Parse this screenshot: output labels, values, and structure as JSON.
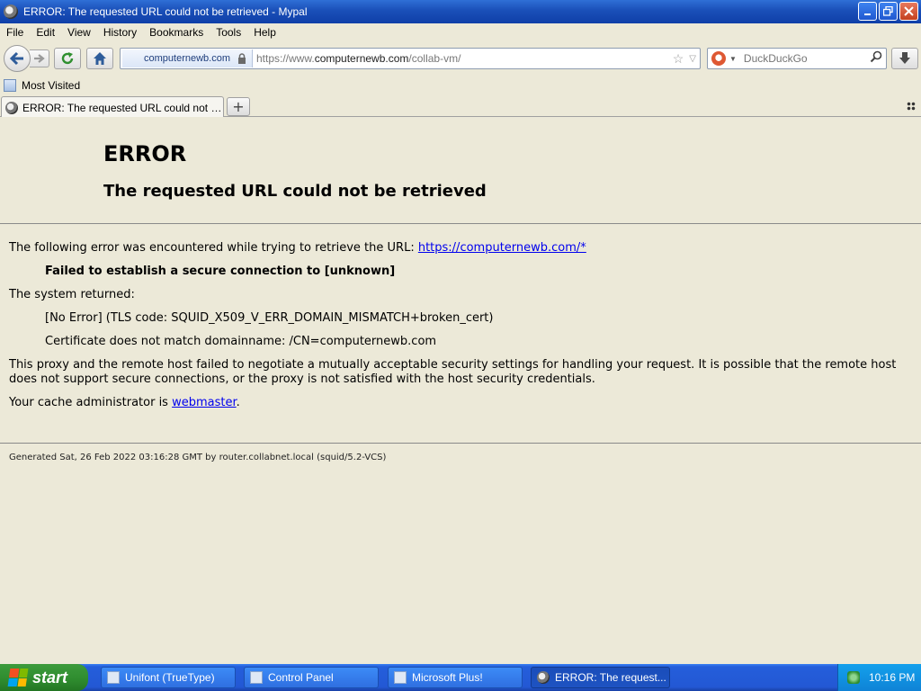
{
  "window": {
    "title": "ERROR: The requested URL could not be retrieved - Mypal"
  },
  "menu": [
    "File",
    "Edit",
    "View",
    "History",
    "Bookmarks",
    "Tools",
    "Help"
  ],
  "navbar": {
    "identity": "computernewb.com",
    "url_prefix": "https://www.",
    "url_domain": "computernewb.com",
    "url_path": "/collab-vm/",
    "search_placeholder": "DuckDuckGo"
  },
  "bookmarks": {
    "most_visited": "Most Visited"
  },
  "tab": {
    "label": "ERROR: The requested URL could not be ret..."
  },
  "page": {
    "heading": "ERROR",
    "subheading": "The requested URL could not be retrieved",
    "intro": "The following error was encountered while trying to retrieve the URL: ",
    "intro_link": "https://computernewb.com/*",
    "failure": "Failed to establish a secure connection to [unknown]",
    "system_returned": "The system returned:",
    "no_error": "[No Error] (TLS code: SQUID_X509_V_ERR_DOMAIN_MISMATCH+broken_cert)",
    "cert_mismatch": "Certificate does not match domainname: /CN=computernewb.com",
    "explanation": "This proxy and the remote host failed to negotiate a mutually acceptable security settings for handling your request. It is possible that the remote host does not support secure connections, or the proxy is not satisfied with the host security credentials.",
    "admin_prefix": "Your cache administrator is ",
    "admin_link": "webmaster",
    "admin_suffix": ".",
    "footer": "Generated Sat, 26 Feb 2022 03:16:28 GMT by router.collabnet.local (squid/5.2-VCS)"
  },
  "taskbar": {
    "start": "start",
    "items": [
      "Unifont (TrueType)",
      "Control Panel",
      "Microsoft Plus!",
      "ERROR: The request..."
    ],
    "clock": "10:16 PM"
  }
}
